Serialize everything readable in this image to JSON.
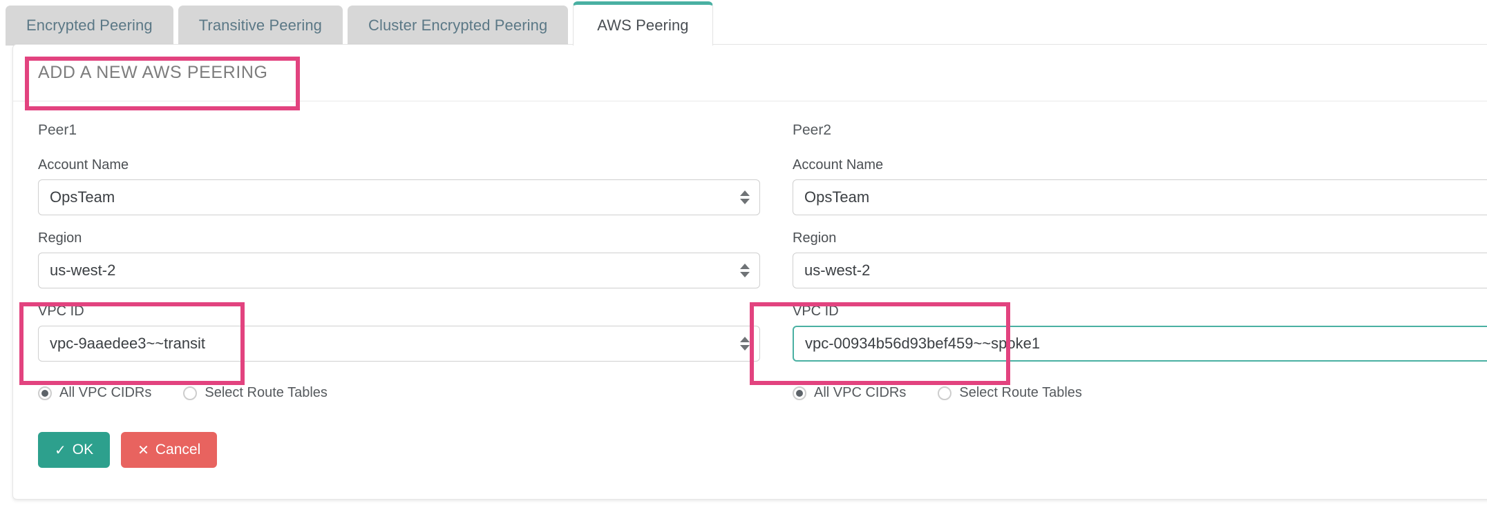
{
  "tabs": [
    {
      "label": "Encrypted Peering",
      "active": false
    },
    {
      "label": "Transitive Peering",
      "active": false
    },
    {
      "label": "Cluster Encrypted Peering",
      "active": false
    },
    {
      "label": "AWS Peering",
      "active": true
    }
  ],
  "card": {
    "title": "ADD A NEW AWS PEERING"
  },
  "peer1": {
    "heading": "Peer1",
    "account_name": {
      "label": "Account Name",
      "value": "OpsTeam"
    },
    "region": {
      "label": "Region",
      "value": "us-west-2"
    },
    "vpc_id": {
      "label": "VPC ID",
      "value": "vpc-9aaedee3~~transit"
    },
    "radios": [
      {
        "label": "All VPC CIDRs",
        "checked": true
      },
      {
        "label": "Select Route Tables",
        "checked": false
      }
    ]
  },
  "peer2": {
    "heading": "Peer2",
    "account_name": {
      "label": "Account Name",
      "value": "OpsTeam"
    },
    "region": {
      "label": "Region",
      "value": "us-west-2"
    },
    "vpc_id": {
      "label": "VPC ID",
      "value": "vpc-00934b56d93bef459~~spoke1"
    },
    "radios": [
      {
        "label": "All VPC CIDRs",
        "checked": true
      },
      {
        "label": "Select Route Tables",
        "checked": false
      }
    ]
  },
  "actions": {
    "ok_label": "OK",
    "ok_icon": "check-icon",
    "ok_glyph": "✓",
    "cancel_label": "Cancel",
    "cancel_icon": "close-icon",
    "cancel_glyph": "✕"
  },
  "colors": {
    "accent_teal": "#2da08d",
    "active_tab_border": "#49b0a2",
    "focus_border": "#49b0a2",
    "danger_red": "#e8635f",
    "annotation_pink": "#e2437f",
    "tab_inactive_bg": "#d7d7d7",
    "tab_inactive_text": "#5b7886"
  },
  "annotations": [
    {
      "name": "title-highlight",
      "target": "ADD A NEW AWS PEERING"
    },
    {
      "name": "peer1-vpc-highlight",
      "target": "VPC ID"
    },
    {
      "name": "peer2-vpc-highlight",
      "target": "VPC ID"
    }
  ]
}
